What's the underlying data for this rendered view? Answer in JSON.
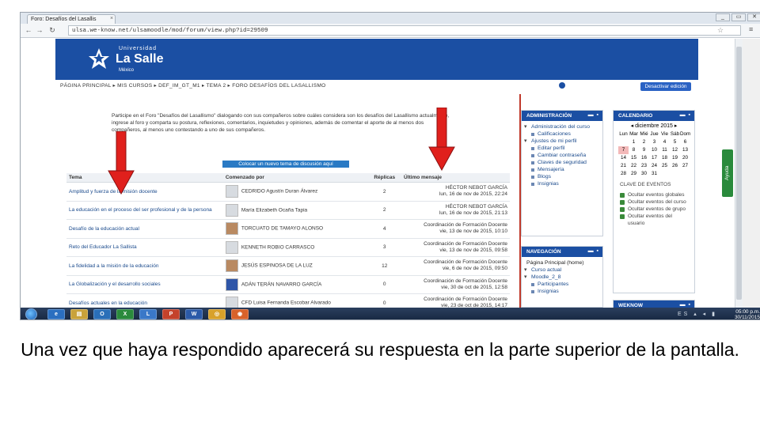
{
  "browser": {
    "tab_title": "Foro: Desafíos del Lasallis",
    "url": "ulsa.we-know.net/ulsamoodle/mod/forum/view.php?id=29509",
    "window_buttons": [
      "_",
      "▭",
      "✕"
    ]
  },
  "site": {
    "logo_top": "Universidad",
    "logo_name": "La Salle",
    "logo_sub": "México"
  },
  "breadcrumb": "PÁGINA PRINCIPAL ▸ MIS CURSOS ▸ DEF_IM_GT_M1 ▸ TEMA 2 ▸ FORO DESAFÍOS DEL LASALLISMO",
  "turn_off_button": "Desactivar edición",
  "intro_text": "Participe en el Foro \"Desafíos del Lasallismo\" dialogando con sus compañeros sobre cuáles considera son los desafíos del Lasallismo actualmente, ingrese al foro y comparta su postura, reflexiones, comentarios, inquietudes y opiniones, además de comentar el aporte de al menos dos compañeros, al menos uno contestando a uno de sus compañeros.",
  "new_discussion_button": "Colocar un nuevo tema de discusión aquí",
  "table": {
    "headers": [
      "Tema",
      "Comenzado por",
      "Réplicas",
      "Último mensaje"
    ],
    "rows": [
      {
        "topic": "Amplitud y fuerza de la misión docente",
        "by": "CEDRIDO Agustín Duran Álvarez",
        "replies": "2",
        "last_name": "HÉCTOR NEBOT GARCÍA",
        "last_date": "lun, 16 de nov de 2015, 22:24",
        "avatar": "default"
      },
      {
        "topic": "La educación en el proceso del ser profesional y de la persona",
        "by": "María Elizabeth Ocaña Tapia",
        "replies": "2",
        "last_name": "HÉCTOR NEBOT GARCÍA",
        "last_date": "lun, 16 de nov de 2015, 21:13",
        "avatar": "default"
      },
      {
        "topic": "Desafío de la educación actual",
        "by": "TORCUATO DE TAMAYO ALONSO",
        "replies": "4",
        "last_name": "Coordinación de Formación Docente",
        "last_date": "vie, 13 de nov de 2015, 10:10",
        "avatar": "photo"
      },
      {
        "topic": "Reto del Educador La Sallista",
        "by": "KENNETH ROBIO CARRASCO",
        "replies": "3",
        "last_name": "Coordinación de Formación Docente",
        "last_date": "vie, 13 de nov de 2015, 09:58",
        "avatar": "default"
      },
      {
        "topic": "La fidelidad a la misión de la educación",
        "by": "JESÚS ESPINOSA DE LA LUZ",
        "replies": "12",
        "last_name": "Coordinación de Formación Docente",
        "last_date": "vie, 6 de nov de 2015, 09:50",
        "avatar": "photo"
      },
      {
        "topic": "La Globalización y el desarrollo sociales",
        "by": "ADÁN TERÁN NAVARRO GARCÍA",
        "replies": "0",
        "last_name": "Coordinación de Formación Docente",
        "last_date": "vie, 30 de oct de 2015, 12:58",
        "avatar": "sr"
      },
      {
        "topic": "Desafíos actuales en la educación",
        "by": "CFD Luisa Fernanda Escobar Alvarado",
        "replies": "0",
        "last_name": "Coordinación de Formación Docente",
        "last_date": "vie, 23 de oct de 2015, 14:17",
        "avatar": "default"
      }
    ]
  },
  "admin_block": {
    "title": "ADMINISTRACIÓN",
    "controls": "▬ ▪",
    "items": [
      {
        "type": "sec",
        "label": "Administración del curso"
      },
      {
        "type": "it",
        "label": "Calificaciones"
      },
      {
        "type": "sec",
        "label": "Ajustes de mi perfil"
      },
      {
        "type": "it",
        "label": "Editar perfil"
      },
      {
        "type": "it",
        "label": "Cambiar contraseña"
      },
      {
        "type": "it",
        "label": "Claves de seguridad"
      },
      {
        "type": "it",
        "label": "Mensajería"
      },
      {
        "type": "it",
        "label": "Blogs"
      },
      {
        "type": "it",
        "label": "Insignias"
      }
    ]
  },
  "nav_block": {
    "title": "NAVEGACIÓN",
    "controls": "▬ ▪",
    "items": [
      {
        "type": "plain",
        "label": "Página Principal (home)"
      },
      {
        "type": "sec",
        "label": "Curso actual"
      },
      {
        "type": "sec",
        "label": "Moodle_2_8"
      },
      {
        "type": "it",
        "label": "Participantes"
      },
      {
        "type": "it",
        "label": "Insignias"
      }
    ]
  },
  "calendar_block": {
    "title": "CALENDARIO",
    "controls": "▬ ▪",
    "month": "◂   diciembre 2015   ▸",
    "weekdays": [
      "Lun",
      "Mar",
      "Mié",
      "Jue",
      "Vie",
      "Sáb",
      "Dom"
    ],
    "days": [
      "",
      "1",
      "2",
      "3",
      "4",
      "5",
      "6",
      "7",
      "8",
      "9",
      "10",
      "11",
      "12",
      "13",
      "14",
      "15",
      "16",
      "17",
      "18",
      "19",
      "20",
      "21",
      "22",
      "23",
      "24",
      "25",
      "26",
      "27",
      "28",
      "29",
      "30",
      "31",
      "",
      "",
      ""
    ],
    "highlight_day": "7",
    "keys_title": "CLAVE DE EVENTOS",
    "keys": [
      "Ocultar eventos globales",
      "Ocultar eventos del curso",
      "Ocultar eventos de grupo",
      "Ocultar eventos del usuario"
    ]
  },
  "weknow_block": {
    "title": "WEKNOW",
    "controls": "▬ ▪"
  },
  "help_tab": "Ayuda",
  "taskbar": {
    "apps": [
      "e",
      "▤",
      "O",
      "X",
      "L",
      "P",
      "W",
      "◎",
      "◉"
    ],
    "tray_time": "05:00 p.m.",
    "tray_date": "30/11/2015",
    "tray_lang": "ES"
  },
  "caption": "Una vez que  haya respondido aparecerá su respuesta en la parte superior de la pantalla."
}
